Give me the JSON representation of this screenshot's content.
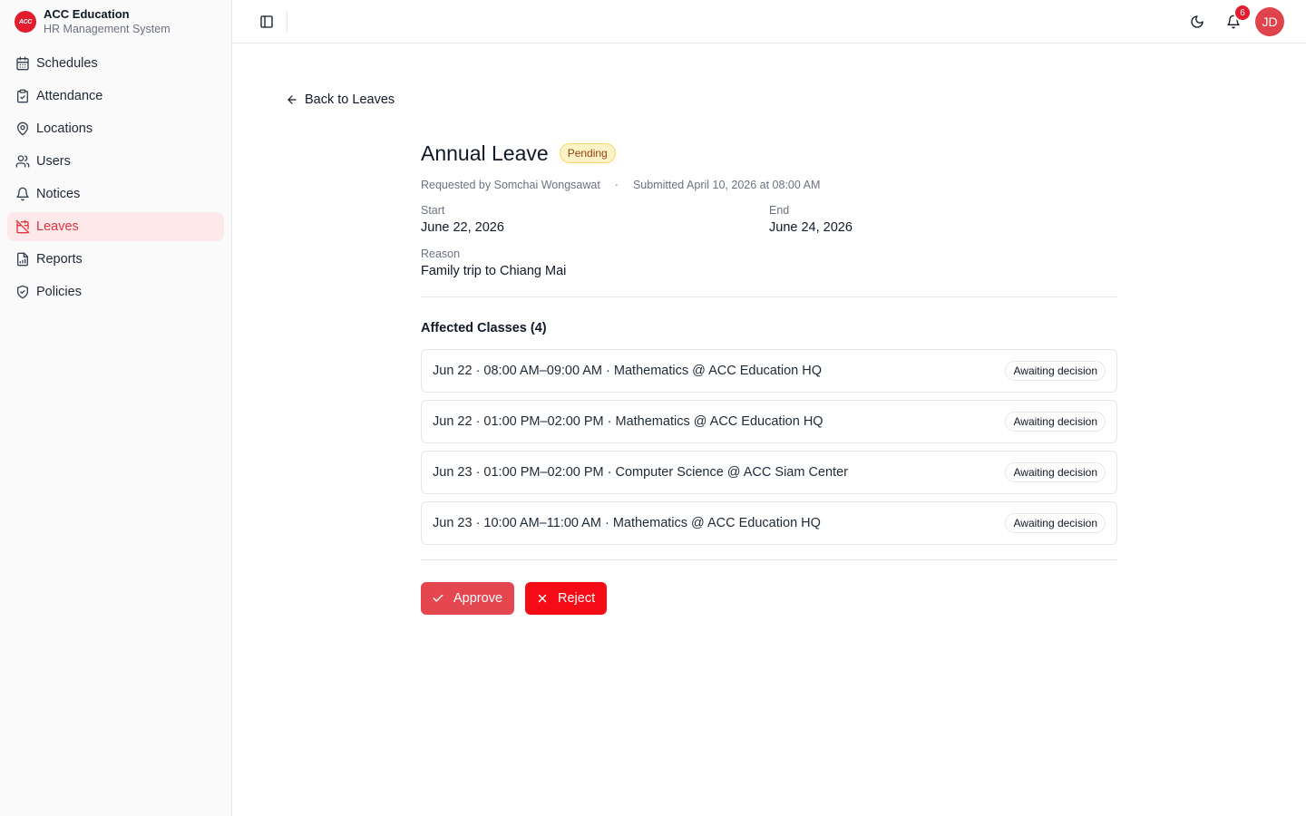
{
  "brand": {
    "logo_text": "ACC",
    "name": "ACC Education",
    "subtitle": "HR Management System"
  },
  "sidebar": {
    "items": [
      {
        "label": "Schedules",
        "icon": "calendar-icon"
      },
      {
        "label": "Attendance",
        "icon": "clipboard-check-icon"
      },
      {
        "label": "Locations",
        "icon": "map-pin-icon"
      },
      {
        "label": "Users",
        "icon": "users-icon"
      },
      {
        "label": "Notices",
        "icon": "bell-icon"
      },
      {
        "label": "Leaves",
        "icon": "calendar-off-icon",
        "active": true
      },
      {
        "label": "Reports",
        "icon": "file-chart-icon"
      },
      {
        "label": "Policies",
        "icon": "shield-check-icon"
      }
    ]
  },
  "topbar": {
    "notification_count": "6",
    "avatar_initials": "JD"
  },
  "back_link": "Back to Leaves",
  "leave": {
    "title": "Annual Leave",
    "status": "Pending",
    "requested_by": "Requested by Somchai Wongsawat",
    "separator": "·",
    "submitted": "Submitted April 10, 2026 at 08:00 AM",
    "start_label": "Start",
    "start_value": "June 22, 2026",
    "end_label": "End",
    "end_value": "June 24, 2026",
    "reason_label": "Reason",
    "reason_value": "Family trip to Chiang Mai"
  },
  "affected": {
    "title": "Affected Classes (4)",
    "classes": [
      {
        "text": "Jun 22 · 08:00 AM–09:00 AM · Mathematics @ ACC Education HQ",
        "status": "Awaiting decision"
      },
      {
        "text": "Jun 22 · 01:00 PM–02:00 PM · Mathematics @ ACC Education HQ",
        "status": "Awaiting decision"
      },
      {
        "text": "Jun 23 · 01:00 PM–02:00 PM · Computer Science @ ACC Siam Center",
        "status": "Awaiting decision"
      },
      {
        "text": "Jun 23 · 10:00 AM–11:00 AM · Mathematics @ ACC Education HQ",
        "status": "Awaiting decision"
      }
    ]
  },
  "actions": {
    "approve_label": "Approve",
    "reject_label": "Reject"
  },
  "colors": {
    "accent": "#e0343f",
    "active_bg": "#fde8ea",
    "pending_bg": "#fef3c7",
    "approve": "#e4474f",
    "reject": "#f40b16"
  }
}
